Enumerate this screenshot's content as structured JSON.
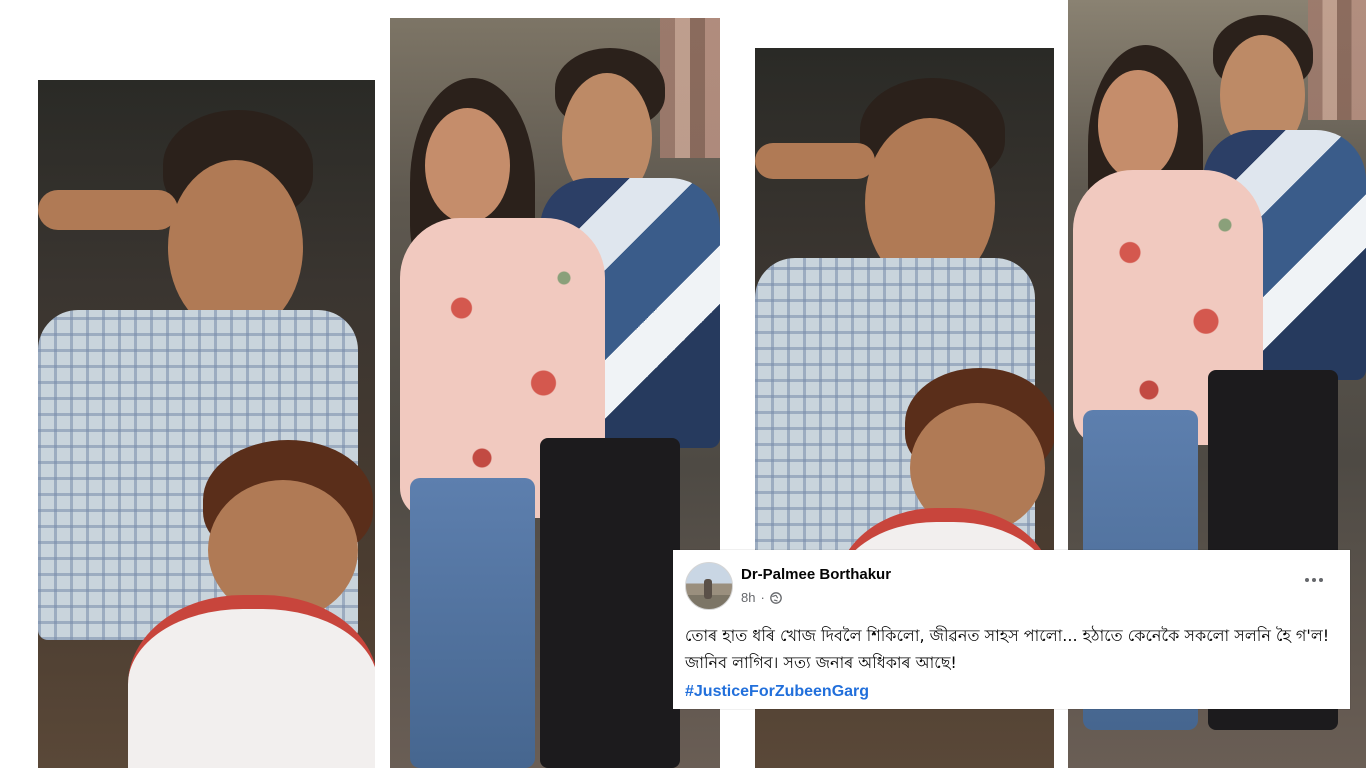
{
  "post": {
    "author": "Dr-Palmee Borthakur",
    "time": "8h",
    "separator": "·",
    "text": "তোৰ হাত ধৰি খোজ দিবলৈ শিকিলো, জীৱনত সাহস পালো... হঠাতে কেনেকৈ সকলো সলনি হৈ গ'ল!  জানিব লাগিব। সত্য জনাৰ অধিকাৰ আছে!",
    "hashtag": "#JusticeForZubeenGarg"
  },
  "icons": {
    "privacy": "globe-icon",
    "menu": "more-options-icon"
  },
  "colors": {
    "hashtag": "#216fdb",
    "name": "#050505",
    "meta": "#65676b"
  }
}
